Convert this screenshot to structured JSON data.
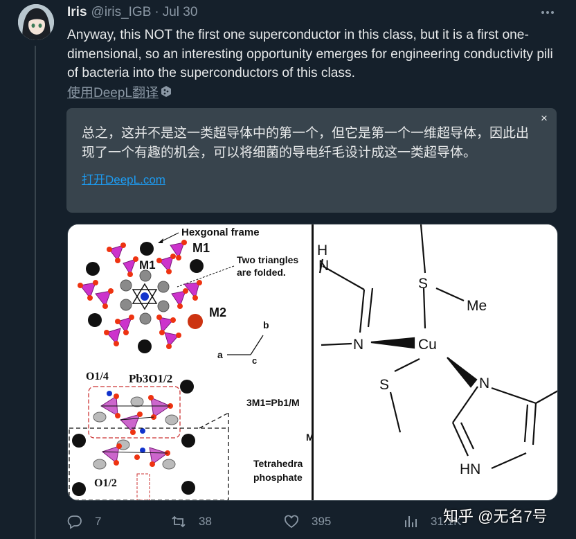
{
  "user": {
    "name": "Iris",
    "handle": "@iris_IGB",
    "separator": "·",
    "date": "Jul 30"
  },
  "tweet": {
    "text": "Anyway, this NOT the first one superconductor in this class, but it is a first one-dimensional, so an interesting opportunity emerges for engineering conductivity pili of bacteria into the superconductors of this class.",
    "translate_label": "使用DeepL翻译"
  },
  "translation": {
    "text": "总之，这并不是这一类超导体中的第一个，但它是第一个一维超导体，因此出现了一个有趣的机会，可以将细菌的导电纤毛设计成这一类超导体。",
    "link": "打开DeepL.com",
    "close_symbol": "×"
  },
  "media": {
    "left_panel": {
      "labels": {
        "hex_frame": "Hexgonal frame",
        "m1": "M1",
        "m1_center": "M1",
        "m2": "M2",
        "two_triangles_1": "Two triangles",
        "two_triangles_2": "are folded.",
        "axis_a": "a",
        "axis_b": "b",
        "axis_c": "c",
        "o14": "O1/4",
        "pb3o12": "Pb3O1/2",
        "o12": "O1/2",
        "eq": "3M1=Pb1/M",
        "m_trunc": "M",
        "tetra": "Tetrahedra",
        "phosphate": "phosphate"
      }
    },
    "right_panel": {
      "labels": {
        "h_top": "H",
        "n_top": "N",
        "n_left": "N",
        "s_top": "S",
        "me": "Me",
        "cu": "Cu",
        "s_bottom": "S",
        "n_right": "N",
        "hn": "HN"
      }
    }
  },
  "actions": {
    "replies": "7",
    "retweets": "38",
    "likes": "395",
    "views": "31.1K"
  },
  "watermark": "知乎 @无名7号",
  "icons": [
    "more-icon",
    "deepl-icon",
    "close-icon",
    "reply-icon",
    "retweet-icon",
    "like-icon",
    "views-icon"
  ]
}
